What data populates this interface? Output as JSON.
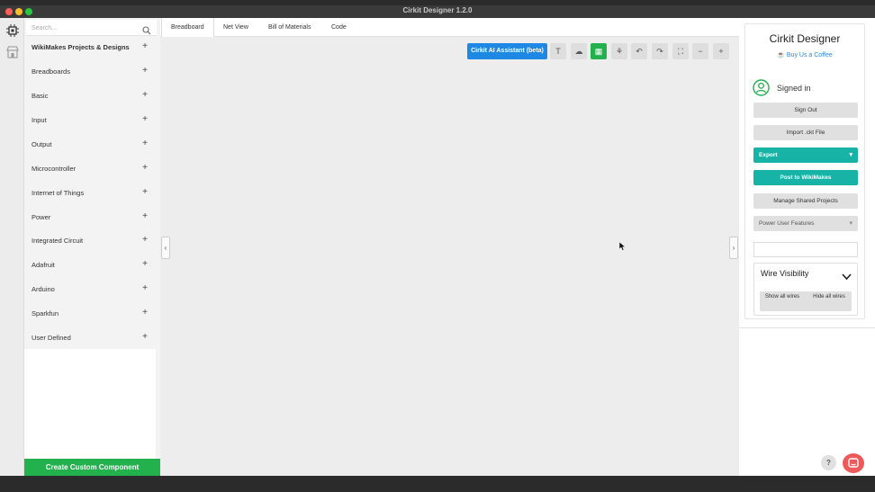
{
  "window": {
    "title": "Cirkit Designer 1.2.0"
  },
  "library": {
    "search_placeholder": "Search...",
    "categories": [
      {
        "label": "WikiMakes Projects & Designs"
      },
      {
        "label": "Breadboards"
      },
      {
        "label": "Basic"
      },
      {
        "label": "Input"
      },
      {
        "label": "Output"
      },
      {
        "label": "Microcontroller"
      },
      {
        "label": "Internet of Things"
      },
      {
        "label": "Power"
      },
      {
        "label": "Integrated Circuit"
      },
      {
        "label": "Adafruit"
      },
      {
        "label": "Arduino"
      },
      {
        "label": "Sparkfun"
      },
      {
        "label": "User Defined"
      }
    ],
    "plus": "+",
    "create_button": "Create Custom Component"
  },
  "tabs": [
    {
      "label": "Breadboard",
      "active": true
    },
    {
      "label": "Net View"
    },
    {
      "label": "Bill of Materials"
    },
    {
      "label": "Code"
    }
  ],
  "toolbar": {
    "ai_button": "Cirkit AI Assistant (beta)",
    "tools": [
      {
        "icon": "text-icon",
        "glyph": "T"
      },
      {
        "icon": "cloud-upload-icon",
        "glyph": "☁"
      },
      {
        "icon": "grid-icon",
        "glyph": "▦"
      },
      {
        "icon": "wire-route-icon",
        "glyph": "⚘"
      },
      {
        "icon": "undo-icon",
        "glyph": "↶"
      },
      {
        "icon": "redo-icon",
        "glyph": "↷"
      },
      {
        "icon": "fit-screen-icon",
        "glyph": "⛶"
      },
      {
        "icon": "zoom-out-icon",
        "glyph": "−"
      },
      {
        "icon": "zoom-in-icon",
        "glyph": "+"
      }
    ],
    "collapse_left": "‹",
    "collapse_right": "›"
  },
  "right_panel": {
    "title": "Cirkit Designer",
    "coffee_link": "Buy Us a Coffee",
    "signed_in": "Signed in",
    "buttons": {
      "sign_out": "Sign Out",
      "import": "Import .ckt File",
      "export": "Export",
      "post": "Post to WikiMakes",
      "manage": "Manage Shared Projects",
      "power_user": "Power User Features"
    },
    "caret": "▾",
    "wire_visibility": {
      "title": "Wire Visibility",
      "show_all": "Show all wires",
      "hide_all": "Hide all wires"
    },
    "help": "?"
  },
  "colors": {
    "accent_blue": "#1e88e5",
    "green": "#22b14c",
    "teal": "#16b3a6",
    "chat_red": "#ee5a5a"
  }
}
